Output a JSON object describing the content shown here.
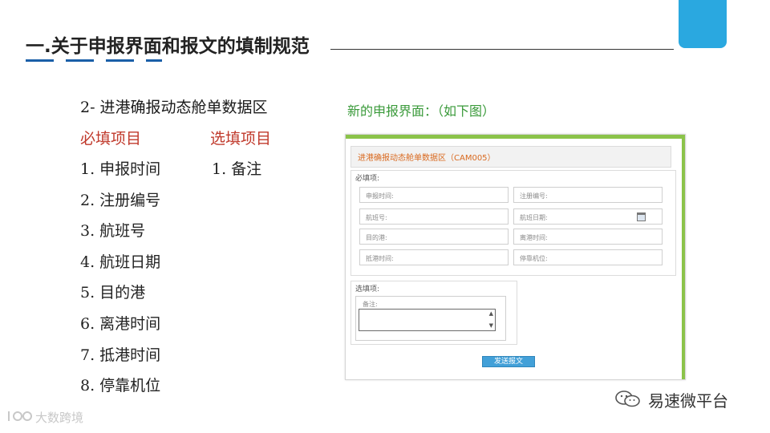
{
  "slide": {
    "title": "一.关于申报界面和报文的填制规范",
    "section_heading": "2- 进港确报动态舱单数据区",
    "required_heading": "必填项目",
    "optional_heading": "选填项目",
    "required_items": [
      "1. 申报时间",
      "2. 注册编号",
      "3. 航班号",
      "4. 航班日期",
      "5. 目的港",
      "6. 离港时间",
      "7. 抵港时间",
      "8. 停靠机位"
    ],
    "optional_items": [
      "1. 备注"
    ],
    "new_ui_heading": "新的申报界面：（如下图）"
  },
  "screenshot": {
    "header": "进港确报动态舱单数据区（CAM005）",
    "required_label": "必填项:",
    "fields": [
      "申报时间:",
      "注册编号:",
      "航班号:",
      "航班日期:",
      "目的港:",
      "离港时间:",
      "抵港时间:",
      "停靠机位:"
    ],
    "optional_label": "选填项:",
    "remark_label": "备注:",
    "submit_label": "发送报文"
  },
  "footer": {
    "brand": "易速微平台",
    "logo_text": "大数跨境"
  },
  "colors": {
    "accent_blue": "#2aa8e0",
    "title_accent": "#1a5fa8",
    "heading_red": "#c0392b",
    "heading_green": "#3a9a3a",
    "screenshot_bar_green": "#8bc34a",
    "screenshot_header_orange": "#d9691f",
    "submit_blue": "#42a0d8"
  },
  "icons": {
    "calendar": "calendar-icon",
    "wechat": "wechat-icon",
    "scroll_up": "▲",
    "scroll_down": "▼"
  }
}
